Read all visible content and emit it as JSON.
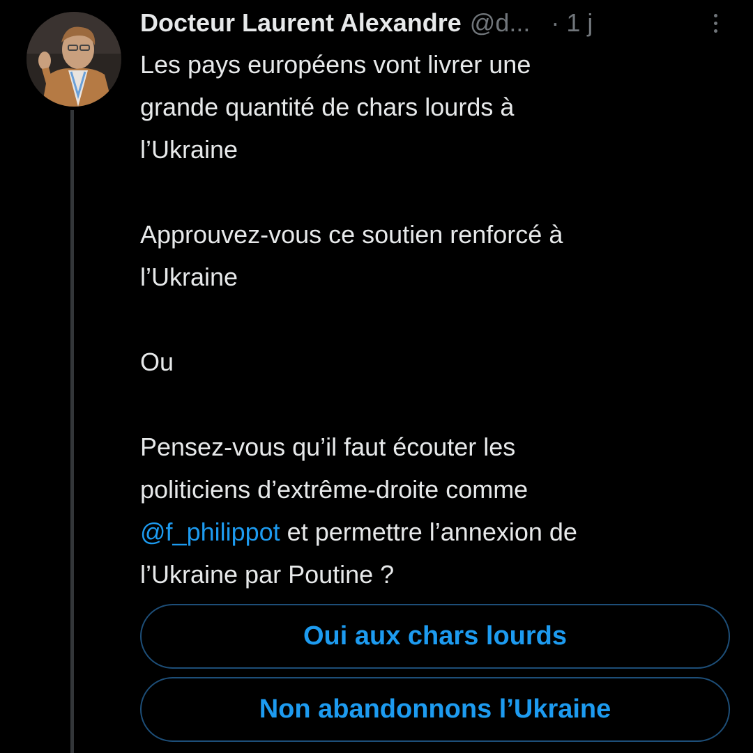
{
  "tweet": {
    "author": {
      "display_name": "Docteur Laurent Alexandre",
      "handle": "@d...",
      "avatar_icon": "profile-photo-avatar"
    },
    "separator": "·",
    "time": "1 j",
    "more_icon": "more-vertical-icon",
    "text": {
      "paragraph_1_line_1": "Les pays européens vont  livrer une",
      "paragraph_1_line_2": "grande quantité de chars lourds à",
      "paragraph_1_line_3": "l’Ukraine",
      "paragraph_2_line_1": "Approuvez-vous ce soutien renforcé à",
      "paragraph_2_line_2": "l’Ukraine",
      "paragraph_3": "Ou",
      "paragraph_4_line_1": "Pensez-vous qu’il faut écouter les",
      "paragraph_4_line_2": "politiciens d’extrême-droite comme",
      "mention": "@f_philippot",
      "paragraph_4_line_3_rest": " et permettre l’annexion de",
      "paragraph_4_line_4": "l’Ukraine par Poutine ?"
    },
    "poll": {
      "options": [
        {
          "label": "Oui aux chars lourds"
        },
        {
          "label": "Non abandonnons l’Ukraine"
        }
      ]
    }
  },
  "colors": {
    "background": "#000000",
    "text": "#e7e9ea",
    "secondary_text": "#71767b",
    "accent": "#1d9bf0",
    "poll_border": "#1d4e78",
    "thread_line": "#333639"
  }
}
